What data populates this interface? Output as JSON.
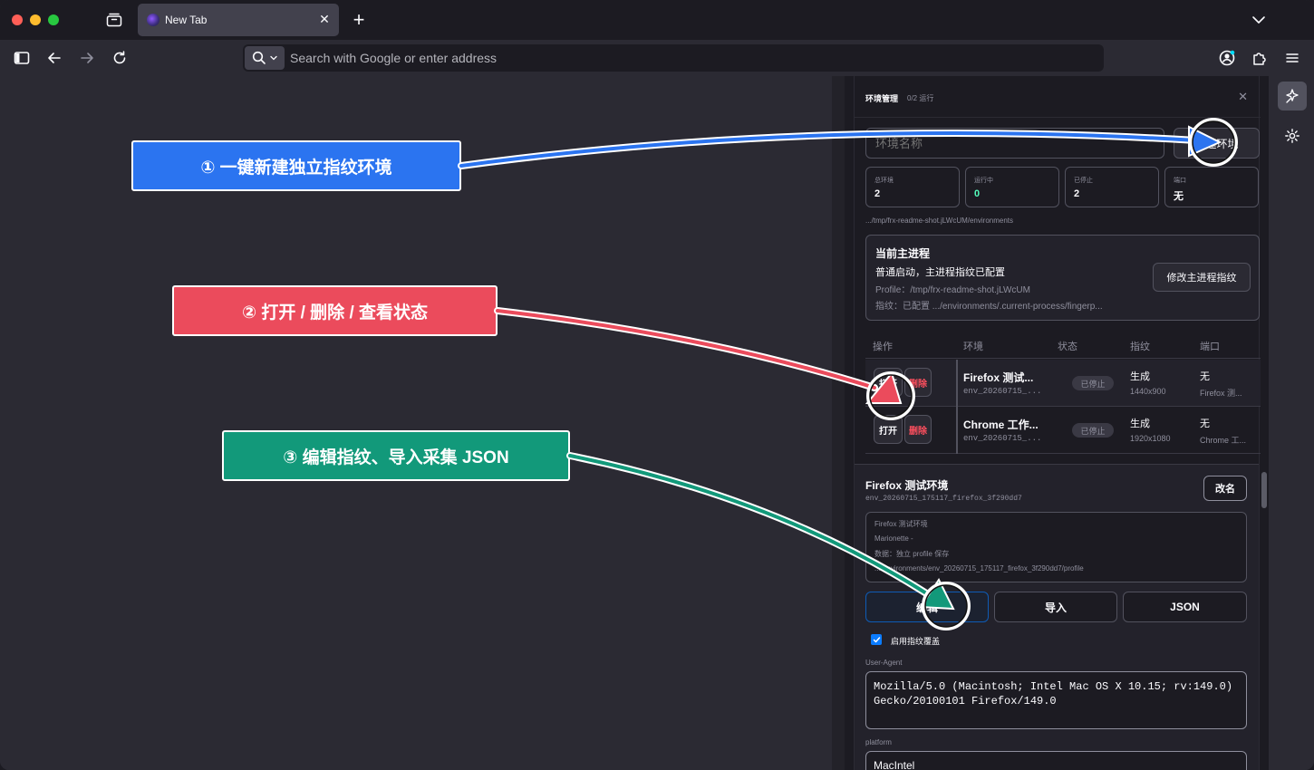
{
  "browser": {
    "tab_title": "New Tab",
    "url_placeholder": "Search with Google or enter address"
  },
  "panel": {
    "title": "环境管理",
    "subtitle": "0/2 运行",
    "env_name_placeholder": "环境名称",
    "new_env_label": "新建环境",
    "stats": [
      {
        "label": "总环境",
        "value": "2"
      },
      {
        "label": "运行中",
        "value": "0"
      },
      {
        "label": "已停止",
        "value": "2"
      },
      {
        "label": "端口",
        "value": "无"
      }
    ],
    "env_path": ".../tmp/frx-readme-shot.jLWcUM/environments",
    "main_process": {
      "title": "当前主进程",
      "status": "普通启动，主进程指纹已配置",
      "profile": "Profile：/tmp/frx-readme-shot.jLWcUM",
      "fingerprint": "指纹：已配置 .../environments/.current-process/fingerp...",
      "edit_button": "修改主进程指纹"
    },
    "table": {
      "headers": [
        "操作",
        "环境",
        "状态",
        "指纹",
        "端口"
      ],
      "rows": [
        {
          "open": "打开",
          "delete": "删除",
          "name": "Firefox 测试...",
          "id": "env_20260715_...",
          "status": "已停止",
          "fp": "生成",
          "res": "1440x900",
          "port": "无",
          "port_sub": "Firefox 测..."
        },
        {
          "open": "打开",
          "delete": "删除",
          "name": "Chrome 工作...",
          "id": "env_20260715_...",
          "status": "已停止",
          "fp": "生成",
          "res": "1920x1080",
          "port": "无",
          "port_sub": "Chrome 工..."
        }
      ]
    },
    "details": {
      "title": "Firefox 测试环境",
      "id": "env_20260715_175117_firefox_3f290dd7",
      "rename": "改名",
      "info": [
        "Firefox 测试环境",
        "Marionette -",
        "数据：独立 profile 保存",
        ".../environments/env_20260715_175117_firefox_3f290dd7/profile"
      ],
      "edit_btn": "编辑",
      "import_btn": "导入",
      "json_btn": "JSON",
      "override_label": "启用指纹覆盖",
      "ua_label": "User-Agent",
      "ua_value": "Mozilla/5.0 (Macintosh; Intel Mac OS X 10.15; rv:149.0) Gecko/20100101 Firefox/149.0",
      "platform_label": "platform",
      "platform_value": "MacIntel"
    }
  },
  "annotations": {
    "callout_1": "① 一键新建独立指纹环境",
    "callout_2": "② 打开 / 删除 / 查看状态",
    "callout_3": "③ 编辑指纹、导入采集 JSON",
    "colors": {
      "blue": "#2b74f0",
      "red": "#eb4b5c",
      "green": "#12997a"
    }
  }
}
